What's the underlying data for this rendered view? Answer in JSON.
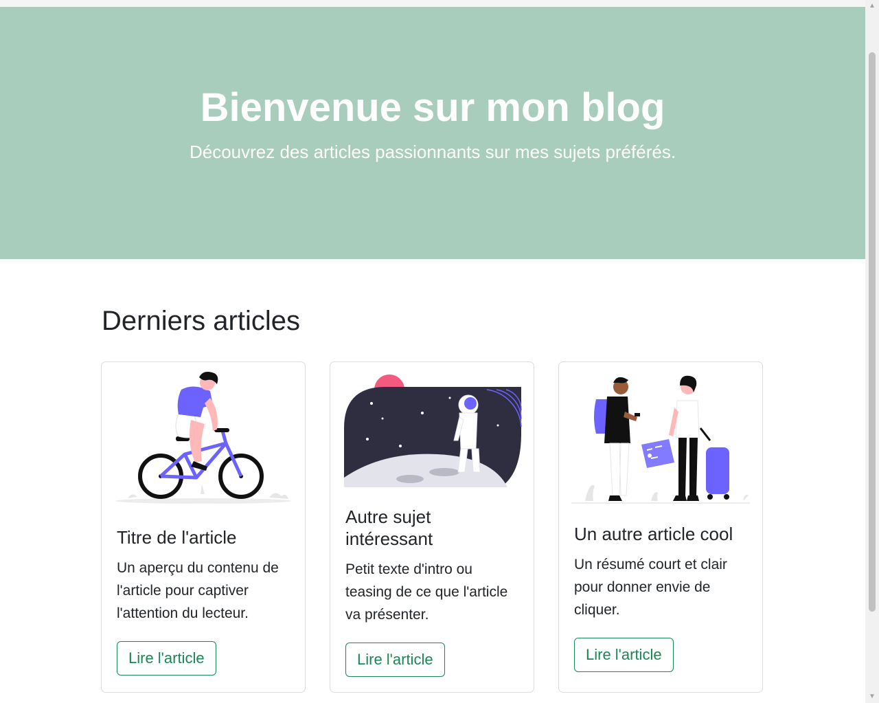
{
  "hero": {
    "title": "Bienvenue sur mon blog",
    "subtitle": "Découvrez des articles passionnants sur mes sujets préférés."
  },
  "section": {
    "title": "Derniers articles"
  },
  "articles": [
    {
      "title": "Titre de l'article",
      "excerpt": "Un aperçu du contenu de l'article pour captiver l'attention du lecteur.",
      "button": "Lire l'article",
      "illustration": "cyclist-icon"
    },
    {
      "title": "Autre sujet intéressant",
      "excerpt": "Petit texte d'intro ou teasing de ce que l'article va présenter.",
      "button": "Lire l'article",
      "illustration": "astronaut-icon"
    },
    {
      "title": "Un autre article cool",
      "excerpt": "Un résumé court et clair pour donner envie de cliquer.",
      "button": "Lire l'article",
      "illustration": "travelers-icon"
    }
  ],
  "colors": {
    "hero_bg": "#a8cdbd",
    "accent": "#198754",
    "illustration_purple": "#6c63ff",
    "space_dark": "#2f2e41"
  }
}
